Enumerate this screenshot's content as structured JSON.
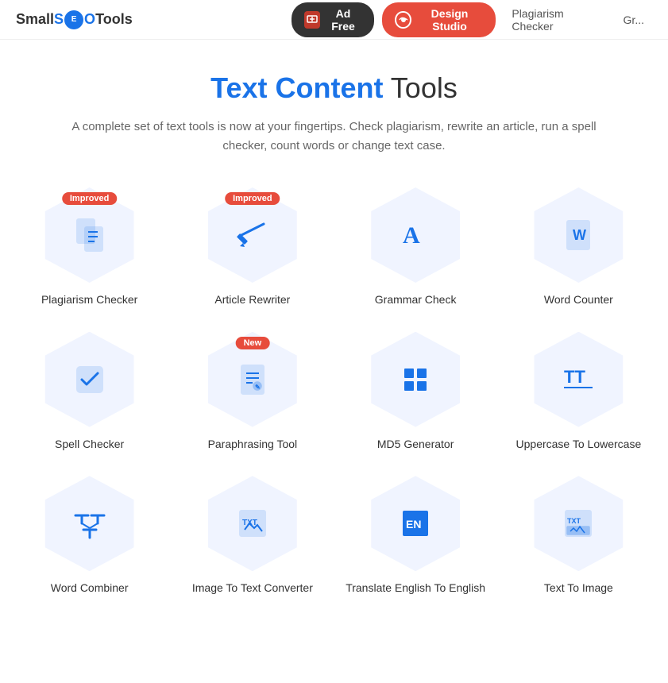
{
  "header": {
    "logo_text_start": "Small",
    "logo_text_seo": "SEO",
    "logo_text_end": "Tools",
    "ad_free_label": "Ad Free",
    "design_studio_label": "Design Studio",
    "nav_items": [
      {
        "label": "Plagiarism Checker",
        "href": "#"
      },
      {
        "label": "Gr...",
        "href": "#"
      }
    ]
  },
  "main": {
    "title_highlight": "Text Content",
    "title_rest": " Tools",
    "subtitle": "A complete set of text tools is now at your fingertips. Check plagiarism, rewrite an article, run a spell checker, count words or change text case.",
    "tools": [
      {
        "id": "plagiarism-checker",
        "label": "Plagiarism Checker",
        "badge": "Improved",
        "badge_type": "improved"
      },
      {
        "id": "article-rewriter",
        "label": "Article Rewriter",
        "badge": "Improved",
        "badge_type": "improved"
      },
      {
        "id": "grammar-check",
        "label": "Grammar Check",
        "badge": null
      },
      {
        "id": "word-counter",
        "label": "Word Counter",
        "badge": null
      },
      {
        "id": "spell-checker",
        "label": "Spell Checker",
        "badge": null
      },
      {
        "id": "paraphrasing-tool",
        "label": "Paraphrasing Tool",
        "badge": "New",
        "badge_type": "new"
      },
      {
        "id": "md5-generator",
        "label": "MD5 Generator",
        "badge": null
      },
      {
        "id": "uppercase-to-lowercase",
        "label": "Uppercase To Lowercase",
        "badge": null
      },
      {
        "id": "word-combiner",
        "label": "Word Combiner",
        "badge": null
      },
      {
        "id": "image-to-text-converter",
        "label": "Image To Text Converter",
        "badge": null
      },
      {
        "id": "translate-english-to-english",
        "label": "Translate English To English",
        "badge": null
      },
      {
        "id": "text-to-image",
        "label": "Text To Image",
        "badge": null
      }
    ]
  }
}
